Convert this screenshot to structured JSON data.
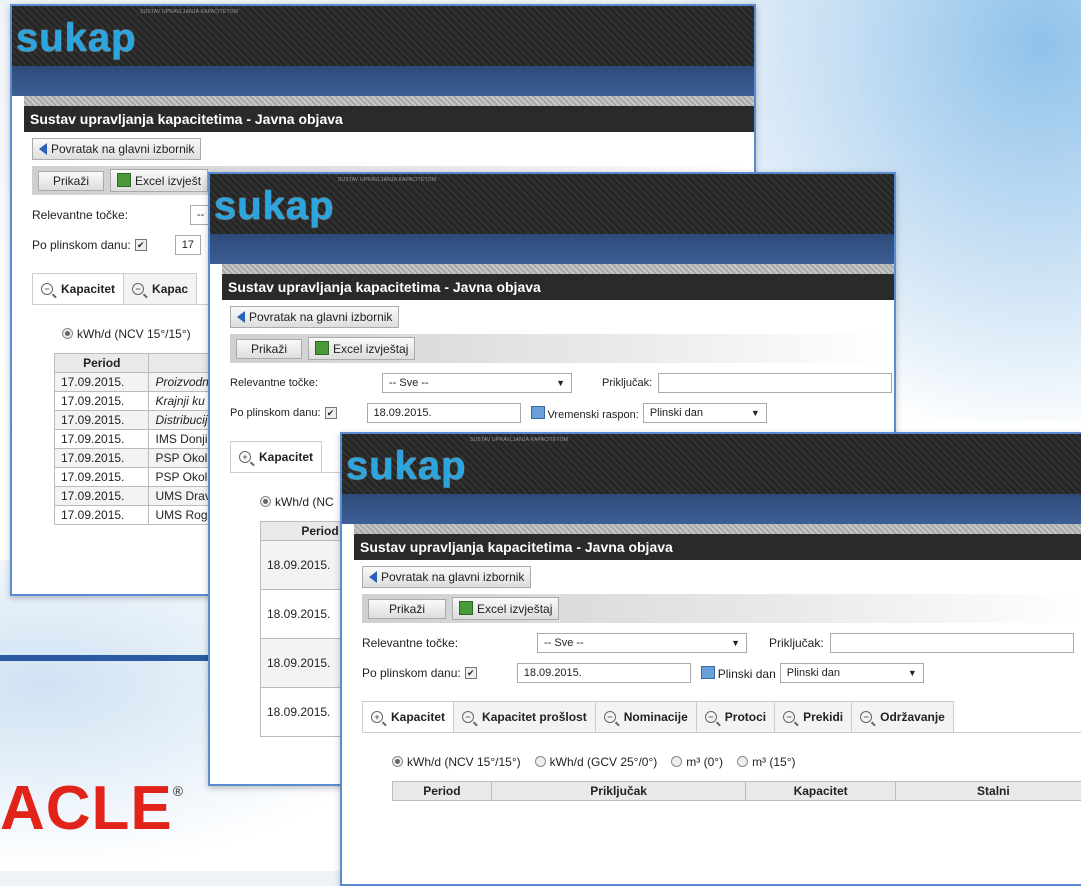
{
  "brand": {
    "logo": "sukap",
    "tagline": "SUSTAV UPRAVLJANJA KAPACITETOM",
    "oracle": "ACLE",
    "oracle_mark": "®"
  },
  "page_title": "Sustav upravljanja kapacitetima - Javna objava",
  "back_label": "Povratak na glavni izbornik",
  "toolbar": {
    "show_label": "Prikaži",
    "excel_label": "Excel izvještaj",
    "excel_label_cut": "Excel izvješt"
  },
  "filters": {
    "points_label": "Relevantne točke:",
    "points_value": "-- Sve --",
    "points_value_cut": "--",
    "connection_label": "Priključak:",
    "gasday_label": "Po plinskom danu:",
    "date1": "17",
    "date2": "18.09.2015.",
    "range_label": "Vremenski raspon:",
    "range_value": "Plinski dan"
  },
  "tabs_full": [
    "Kapacitet",
    "Kapacitet prošlost",
    "Nominacije",
    "Protoci",
    "Prekidi",
    "Održavanje"
  ],
  "tabs_cut1": [
    "Kapacitet",
    "Kapac"
  ],
  "units": [
    "kWh/d (NCV 15°/15°)",
    "kWh/d (GCV 25°/0°)",
    "m³ (0°)",
    "m³ (15°)"
  ],
  "units_cut1": "kWh/d (NCV 15°/15°)",
  "units_cut2": "kWh/d (NC",
  "table1": {
    "header": "Period",
    "rows": [
      [
        "17.09.2015.",
        "Proizvodn"
      ],
      [
        "17.09.2015.",
        "Krajnji ku"
      ],
      [
        "17.09.2015.",
        "Distribucij"
      ],
      [
        "17.09.2015.",
        "IMS Donji"
      ],
      [
        "17.09.2015.",
        "PSP Okol"
      ],
      [
        "17.09.2015.",
        "PSP Okol"
      ],
      [
        "17.09.2015.",
        "UMS Drav"
      ],
      [
        "17.09.2015.",
        "UMS Rog"
      ]
    ]
  },
  "table2": {
    "header": "Period",
    "rows": [
      "18.09.2015.",
      "18.09.2015.",
      "18.09.2015.",
      "18.09.2015."
    ]
  },
  "table3": {
    "headers": [
      "Period",
      "Priključak",
      "Kapacitet",
      "Stalni"
    ]
  }
}
